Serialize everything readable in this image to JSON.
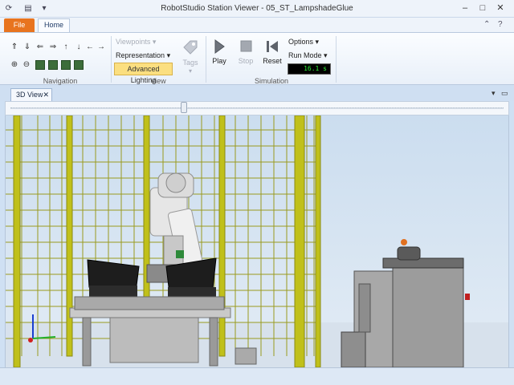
{
  "window": {
    "title": "RobotStudio Station Viewer - 05_ST_LampshadeGlue"
  },
  "tabs": {
    "file": "File",
    "home": "Home"
  },
  "ribbon": {
    "navigation": {
      "label": "Navigation"
    },
    "view": {
      "label": "View",
      "viewpoints": "Viewpoints",
      "representation": "Representation",
      "advanced_lighting": "Advanced Lighting"
    },
    "tags": {
      "label": "Tags"
    },
    "simulation": {
      "label": "Simulation",
      "play": "Play",
      "stop": "Stop",
      "reset": "Reset",
      "options": "Options",
      "run_mode": "Run Mode",
      "time_display": "16.1 s"
    }
  },
  "document": {
    "tab_label": "3D View"
  },
  "timeline": {
    "position": 0.35
  },
  "colors": {
    "file_tab": "#e8741f",
    "fence": "#b8b81a",
    "robot": "#e6e6e6",
    "timer_text": "#2df03a",
    "highlight": "#fbdf80"
  }
}
